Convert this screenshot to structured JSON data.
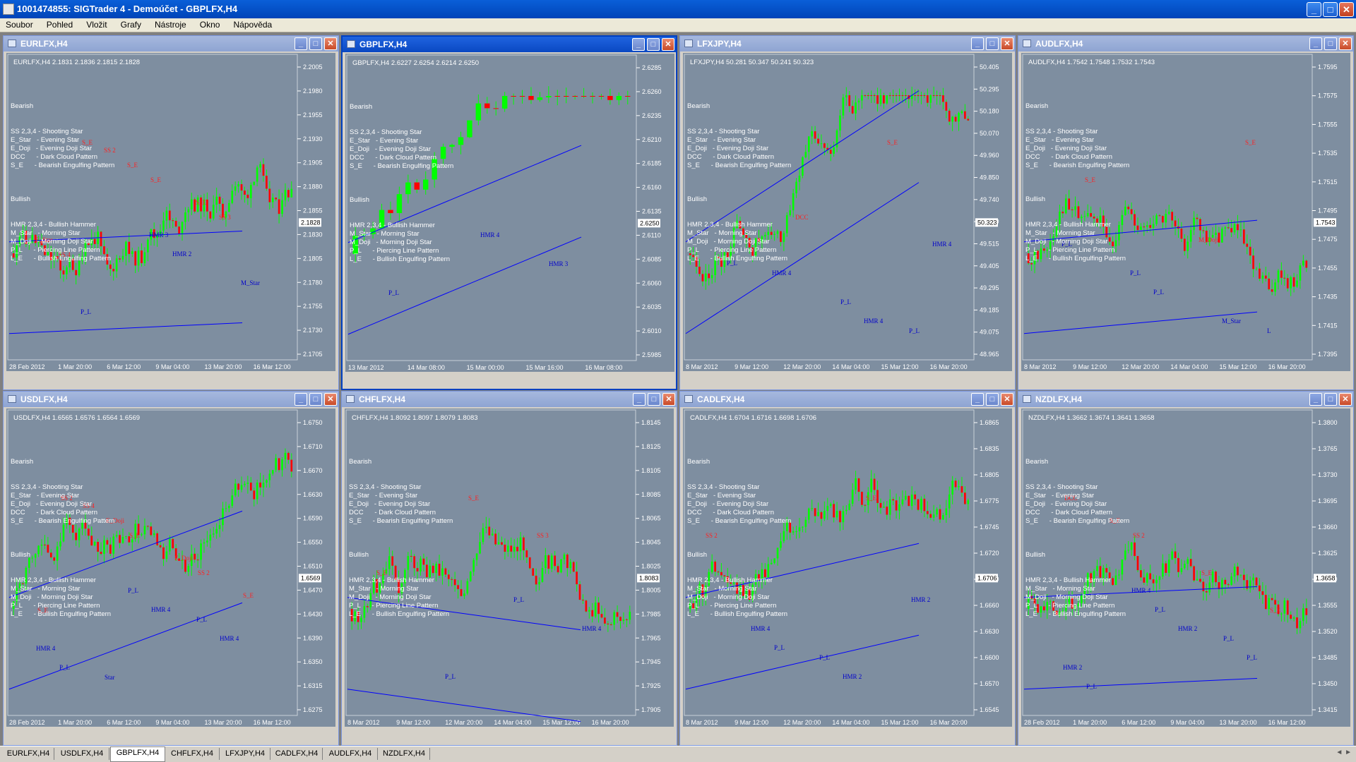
{
  "app": {
    "title": "1001474855: SIGTrader 4 - Demoúčet - GBPLFX,H4",
    "min_glyph": "_",
    "max_glyph": "□",
    "close_glyph": "✕"
  },
  "menu": [
    "Soubor",
    "Pohled",
    "Vložit",
    "Grafy",
    "Nástroje",
    "Okno",
    "Nápověda"
  ],
  "legend": {
    "bearish_head": "Bearish",
    "bearish": [
      "SS 2,3,4 - Shooting Star",
      "E_Star   - Evening Star",
      "E_Doji   - Evening Doji Star",
      "DCC      - Dark Cloud Pattern",
      "S_E      - Bearish Engulfing Pattern"
    ],
    "bullish_head": "Bullish",
    "bullish": [
      "HMR 2,3,4 - Bullish Hammer",
      "M_Star   - Morning Star",
      "M_Doji   - Morning Doji Star",
      "P_L      - Piercing Line Pattern",
      "L_E      - Bullish Engulfing Pattern"
    ]
  },
  "colors": {
    "bull": "#00ff00",
    "bear": "#ff0000",
    "line": "#0000ff",
    "plot_bg": "#7e8ea0",
    "marker_bear": "#ff2020",
    "marker_bull": "#0000cc"
  },
  "charts": [
    {
      "title": "EURLFX,H4",
      "info": "EURLFX,H4  2.1831 2.1836 2.1815 2.1828",
      "price_labels": [
        "2.2005",
        "2.1980",
        "2.1955",
        "2.1930",
        "2.1905",
        "2.1880",
        "2.1855",
        "2.1830",
        "2.1805",
        "2.1780",
        "2.1755",
        "2.1730",
        "2.1705"
      ],
      "current": "2.1828",
      "dates": [
        "28 Feb 2012",
        "1 Mar 20:00",
        "6 Mar 12:00",
        "9 Mar 04:00",
        "13 Mar 20:00",
        "16 Mar 12:00"
      ],
      "markers": [
        "S_E",
        "S_E",
        "SS 3",
        "SS 4",
        "S_E",
        "S_E",
        "E_Star",
        "SS 2",
        "HMR 2",
        "M_Star",
        "P_L",
        "HMR 3"
      ]
    },
    {
      "title": "GBPLFX,H4",
      "info": "GBPLFX,H4  2.6227 2.6254 2.6214 2.6250",
      "price_labels": [
        "2.6285",
        "2.6260",
        "2.6235",
        "2.6210",
        "2.6185",
        "2.6160",
        "2.6135",
        "2.6110",
        "2.6085",
        "2.6060",
        "2.6035",
        "2.6010",
        "2.5985"
      ],
      "current": "2.6250",
      "dates": [
        "13 Mar 2012",
        "14 Mar 08:00",
        "15 Mar 00:00",
        "15 Mar 16:00",
        "16 Mar 08:00"
      ],
      "markers": [
        "HMR 4",
        "HMR 3",
        "P_L"
      ]
    },
    {
      "title": "LFXJPY,H4",
      "info": "LFXJPY,H4  50.281 50.347 50.241 50.323",
      "price_labels": [
        "50.405",
        "50.295",
        "50.180",
        "50.070",
        "49.960",
        "49.850",
        "49.740",
        "49.630",
        "49.515",
        "49.405",
        "49.295",
        "49.185",
        "49.075",
        "48.965"
      ],
      "current": "50.323",
      "dates": [
        "8 Mar 2012",
        "9 Mar 12:00",
        "12 Mar 20:00",
        "14 Mar 04:00",
        "15 Mar 12:00",
        "16 Mar 20:00"
      ],
      "markers": [
        "S_E",
        "P_L",
        "DCC",
        "HMR 4",
        "HMR 4",
        "HMR 4",
        "P_L",
        "P_L"
      ]
    },
    {
      "title": "AUDLFX,H4",
      "info": "AUDLFX,H4  1.7542 1.7548 1.7532 1.7543",
      "price_labels": [
        "1.7595",
        "1.7575",
        "1.7555",
        "1.7535",
        "1.7515",
        "1.7495",
        "1.7475",
        "1.7455",
        "1.7435",
        "1.7415",
        "1.7395"
      ],
      "current": "1.7543",
      "dates": [
        "8 Mar 2012",
        "9 Mar 12:00",
        "12 Mar 20:00",
        "14 Mar 04:00",
        "15 Mar 12:00",
        "16 Mar 20:00"
      ],
      "markers": [
        "S_E",
        "S_E",
        "P_L",
        "M_Star",
        "P_L",
        "P_L",
        "M_Doji",
        "L"
      ]
    },
    {
      "title": "USDLFX,H4",
      "info": "USDLFX,H4  1.6565 1.6576 1.6564 1.6569",
      "price_labels": [
        "1.6750",
        "1.6710",
        "1.6670",
        "1.6630",
        "1.6590",
        "1.6550",
        "1.6510",
        "1.6470",
        "1.6430",
        "1.6390",
        "1.6350",
        "1.6315",
        "1.6275"
      ],
      "current": "1.6569",
      "dates": [
        "28 Feb 2012",
        "1 Mar 20:00",
        "6 Mar 12:00",
        "9 Mar 04:00",
        "13 Mar 20:00",
        "16 Mar 12:00"
      ],
      "markers": [
        "SS 2",
        "S_E",
        "SS 2",
        "S_E",
        "E_Doji",
        "E_Doji",
        "S_E",
        "SS 4",
        "HMR 4",
        "HMR 4",
        "P_L",
        "P_L",
        "P_L",
        "HMR 4",
        "Star"
      ]
    },
    {
      "title": "CHFLFX,H4",
      "info": "CHFLFX,H4  1.8092 1.8097 1.8079 1.8083",
      "price_labels": [
        "1.8145",
        "1.8125",
        "1.8105",
        "1.8085",
        "1.8065",
        "1.8045",
        "1.8025",
        "1.8005",
        "1.7985",
        "1.7965",
        "1.7945",
        "1.7925",
        "1.7905"
      ],
      "current": "1.8083",
      "dates": [
        "8 Mar 2012",
        "9 Mar 12:00",
        "12 Mar 20:00",
        "14 Mar 04:00",
        "15 Mar 12:00",
        "16 Mar 20:00"
      ],
      "markers": [
        "S_E",
        "SS 3",
        "S_E",
        "P_L",
        "P_L",
        "HMR 4"
      ]
    },
    {
      "title": "CADLFX,H4",
      "info": "CADLFX,H4  1.6704 1.6716 1.6698 1.6706",
      "price_labels": [
        "1.6865",
        "1.6835",
        "1.6805",
        "1.6775",
        "1.6745",
        "1.6720",
        "1.6690",
        "1.6660",
        "1.6630",
        "1.6600",
        "1.6570",
        "1.6545"
      ],
      "current": "1.6706",
      "dates": [
        "8 Mar 2012",
        "9 Mar 12:00",
        "12 Mar 20:00",
        "14 Mar 04:00",
        "15 Mar 12:00",
        "16 Mar 20:00"
      ],
      "markers": [
        "S_E",
        "SS 2",
        "P_L",
        "HMR 2",
        "HMR 2",
        "HMR 4",
        "P_L"
      ]
    },
    {
      "title": "NZDLFX,H4",
      "info": "NZDLFX,H4  1.3662 1.3674 1.3641 1.3658",
      "price_labels": [
        "1.3800",
        "1.3765",
        "1.3730",
        "1.3695",
        "1.3660",
        "1.3625",
        "1.3590",
        "1.3555",
        "1.3520",
        "1.3485",
        "1.3450",
        "1.3415"
      ],
      "current": "1.3658",
      "dates": [
        "28 Feb 2012",
        "1 Mar 20:00",
        "6 Mar 12:00",
        "9 Mar 04:00",
        "13 Mar 20:00",
        "16 Mar 12:00"
      ],
      "markers": [
        "DCC",
        "SS 2",
        "S_E",
        "S_E",
        "S_E",
        "HMR 2",
        "P_L",
        "P_L",
        "P_L",
        "P_L",
        "HMR 2",
        "HMR 4"
      ]
    }
  ],
  "tabs": [
    "EURLFX,H4",
    "USDLFX,H4",
    "GBPLFX,H4",
    "CHFLFX,H4",
    "LFXJPY,H4",
    "CADLFX,H4",
    "AUDLFX,H4",
    "NZDLFX,H4"
  ],
  "active_tab": "GBPLFX,H4",
  "scroll_arrows": "◄ ►"
}
